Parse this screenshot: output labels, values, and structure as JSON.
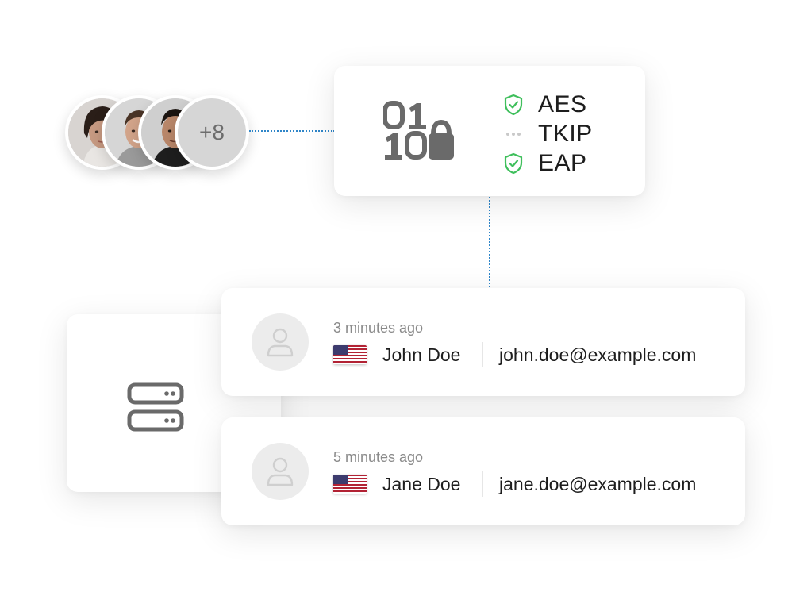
{
  "avatars": {
    "people": [
      {
        "name": "avatar-woman"
      },
      {
        "name": "avatar-man-1"
      },
      {
        "name": "avatar-man-2"
      }
    ],
    "more_label": "+8"
  },
  "encryption": {
    "icon": "binary-lock-icon",
    "protocols": [
      {
        "label": "AES",
        "status": "enabled",
        "icon": "shield-check-icon"
      },
      {
        "label": "TKIP",
        "status": "disabled",
        "icon": "dots-icon"
      },
      {
        "label": "EAP",
        "status": "enabled",
        "icon": "shield-check-icon"
      }
    ],
    "colors": {
      "enabled": "#3fbf5c",
      "disabled": "#c9c9c9",
      "connector": "#2f86c9"
    }
  },
  "server": {
    "icon": "server-icon"
  },
  "sessions": [
    {
      "time": "3 minutes ago",
      "flag": "us-flag-icon",
      "name": "John Doe",
      "email": "john.doe@example.com"
    },
    {
      "time": "5 minutes ago",
      "flag": "us-flag-icon",
      "name": "Jane Doe",
      "email": "jane.doe@example.com"
    }
  ]
}
